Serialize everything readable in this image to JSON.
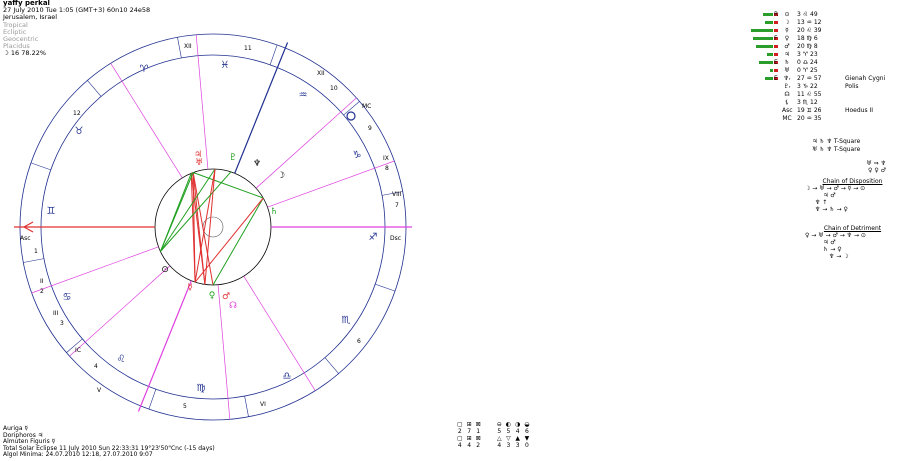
{
  "header": {
    "name": "yaffy perkal",
    "datetime": "27 July 2010  Tue   1:05 (GMT+3) 60n10  24e58",
    "location": "Jerusalem, Israel",
    "settings": [
      "Tropical",
      "Ecliptic",
      "Geocentric",
      "Placidus"
    ],
    "moon_phase": "☽ 16 78.22%"
  },
  "wheel": {
    "house_numbers": [
      "1",
      "2",
      "3",
      "4",
      "5",
      "6",
      "7",
      "8",
      "9",
      "10",
      "11",
      "12"
    ],
    "house_roman": [
      "XII",
      "XI",
      "IX",
      "VIII",
      "II",
      "III",
      "V",
      "VI"
    ],
    "angles": {
      "asc": "Asc",
      "dsc": "Dsc",
      "mc": "MC",
      "ic": "IC"
    },
    "zodiac_signs": [
      "♈",
      "♉",
      "♊",
      "♋",
      "♌",
      "♍",
      "♎",
      "♏",
      "♐",
      "♑",
      "♒",
      "♓"
    ],
    "planet_glyphs": [
      "⊙",
      "☽",
      "☿",
      "♀",
      "♂",
      "♃",
      "♄",
      "♅",
      "♆",
      "♇",
      "☊"
    ],
    "colors": {
      "red": "#e03030",
      "green": "#20a020",
      "magenta": "#e040e0",
      "blue": "#203090",
      "ring": "#203090"
    }
  },
  "planets": [
    {
      "glyph": "⊙",
      "pos": "3 ♌ 49",
      "status": "",
      "strength": 10,
      "mark": "R"
    },
    {
      "glyph": "☽",
      "pos": "13 ♒ 12",
      "status": "",
      "strength": 8,
      "mark": ""
    },
    {
      "glyph": "☿",
      "pos": "20 ♌ 39",
      "status": "",
      "strength": 22,
      "mark": ""
    },
    {
      "glyph": "♀",
      "pos": "18 ♍ 6",
      "status": "",
      "strength": 20,
      "mark": "F"
    },
    {
      "glyph": "♂",
      "pos": "20 ♍ 8",
      "status": "",
      "strength": 17,
      "mark": ""
    },
    {
      "glyph": "♃",
      "pos": "3 ♈ 23",
      "status": "",
      "strength": 6,
      "mark": ""
    },
    {
      "glyph": "♄",
      "pos": "0 ♎ 24",
      "status": "",
      "strength": 14,
      "mark": "E"
    },
    {
      "glyph": "♅",
      "pos": "0 ♈ 25",
      "status": "",
      "strength": 3,
      "mark": ""
    },
    {
      "glyph": "♆ᵣ",
      "pos": "27 ♒ 57",
      "status": "Gienah Cygni",
      "strength": 8,
      "mark": "E"
    },
    {
      "glyph": "♇ᵣ",
      "pos": "3 ♑ 22",
      "status": "Polis",
      "strength": 0,
      "mark": ""
    },
    {
      "glyph": "☊",
      "pos": "11 ♌ 55",
      "status": "",
      "strength": 0,
      "mark": ""
    },
    {
      "glyph": "⚸",
      "pos": "3 ♏ 12",
      "status": "",
      "strength": 0,
      "mark": ""
    },
    {
      "glyph": "Asc",
      "pos": "19 ♊ 26",
      "status": "Hoedus II",
      "strength": 0,
      "mark": ""
    },
    {
      "glyph": "MC",
      "pos": "20 ♒ 35",
      "status": "",
      "strength": 0,
      "mark": ""
    }
  ],
  "aspect_patterns": [
    "♃ ♄ ♆  T-Square",
    "♅ ♄ ♆  T-Square"
  ],
  "chains": {
    "top_lines": [
      "♅ ⇒ ♆",
      "♀ ♀ ♂"
    ],
    "disposition_title": "Chain of Disposition",
    "disposition_lines": [
      "☽ → ♅ → ♂ → ☿ → ⊙",
      "♃ ♂",
      "♆ ↑",
      "♆ → ♄ → ♀"
    ],
    "detriment_title": "Chain of Detriment",
    "detriment_lines": [
      "♀ → ♅ → ♂ → ♆ → ⊙",
      "♃ ♂",
      "♄ → ♀",
      "♆ → ☽"
    ]
  },
  "modality": {
    "row1_glyphs": [
      "▢",
      "⊞",
      "⊠",
      "⊖",
      "◐",
      "◑",
      "◒"
    ],
    "row1_values": [
      "2",
      "7",
      "1",
      "5",
      "5",
      "4",
      "6"
    ],
    "row2_glyphs": [
      "▢",
      "⊞",
      "⊠",
      "△",
      "▽",
      "▲",
      "▼"
    ],
    "row2_values": [
      "4",
      "4",
      "2",
      "4",
      "3",
      "3",
      "0"
    ]
  },
  "footer": {
    "auriga": "Auriga  ☿",
    "doriphoros": "Doriphoros  ♃",
    "almuten": "Almuten Figuris  ☿",
    "eclipse": "Total Solar Eclipse 11 July 2010 Sun 22:33:31 19°23'50\"Cnc (-15 days)",
    "algol": "Algol Minima: 24.07.2010 12:18,  27.07.2010 9:07"
  }
}
